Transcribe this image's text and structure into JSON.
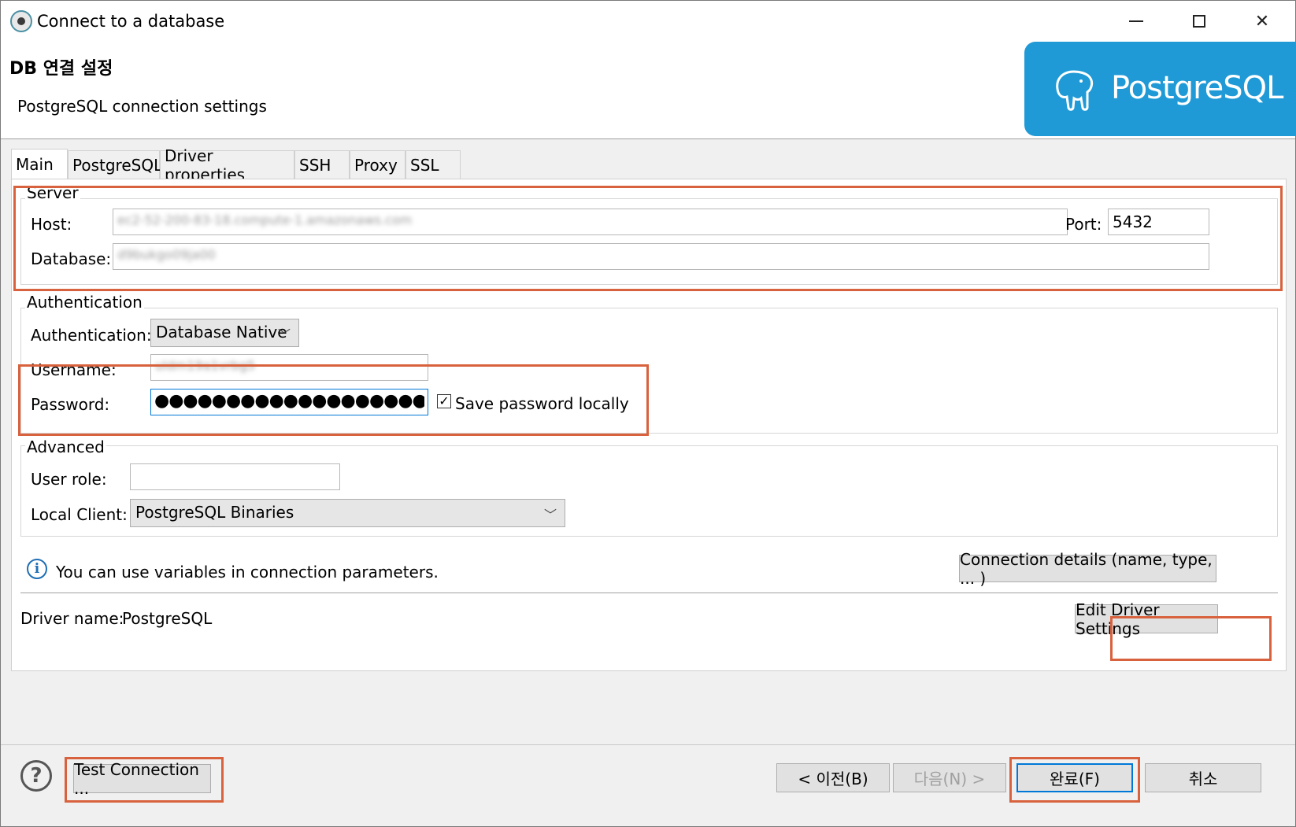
{
  "window": {
    "title": "Connect to a database"
  },
  "header": {
    "title": "DB 연결 설정",
    "subtitle": "PostgreSQL connection settings",
    "logo_text": "PostgreSQL"
  },
  "tabs": [
    {
      "label": "Main",
      "active": true
    },
    {
      "label": "PostgreSQL",
      "active": false
    },
    {
      "label": "Driver properties",
      "active": false
    },
    {
      "label": "SSH",
      "active": false
    },
    {
      "label": "Proxy",
      "active": false
    },
    {
      "label": "SSL",
      "active": false
    }
  ],
  "server": {
    "group_label": "Server",
    "host_label": "Host:",
    "host_value": "ec2-52-200-83-18.compute-1.amazonaws.com",
    "port_label": "Port:",
    "port_value": "5432",
    "database_label": "Database:",
    "database_value": "d9bukgo09ja00"
  },
  "authentication": {
    "group_label": "Authentication",
    "auth_label": "Authentication:",
    "auth_value": "Database Native",
    "username_label": "Username:",
    "username_value": "uldm19a1vrbg5",
    "password_label": "Password:",
    "password_value": "●●●●●●●●●●●●●●●●●●●",
    "save_password_label": "Save password locally",
    "save_password_checked": true
  },
  "advanced": {
    "group_label": "Advanced",
    "user_role_label": "User role:",
    "user_role_value": "",
    "local_client_label": "Local Client:",
    "local_client_value": "PostgreSQL Binaries"
  },
  "info": {
    "text": "You can use variables in connection parameters.",
    "connection_details_button": "Connection details (name, type, ... )"
  },
  "driver": {
    "label": "Driver name:",
    "value": "PostgreSQL",
    "edit_button": "Edit Driver Settings"
  },
  "footer": {
    "test_connection_button": "Test Connection ...",
    "back_button": "< 이전(B)",
    "next_button": "다음(N) >",
    "finish_button": "완료(F)",
    "cancel_button": "취소"
  },
  "colors": {
    "highlight_border": "#d9623e",
    "logo_background": "#1f9ad6",
    "primary_button_border": "#0078d7"
  }
}
